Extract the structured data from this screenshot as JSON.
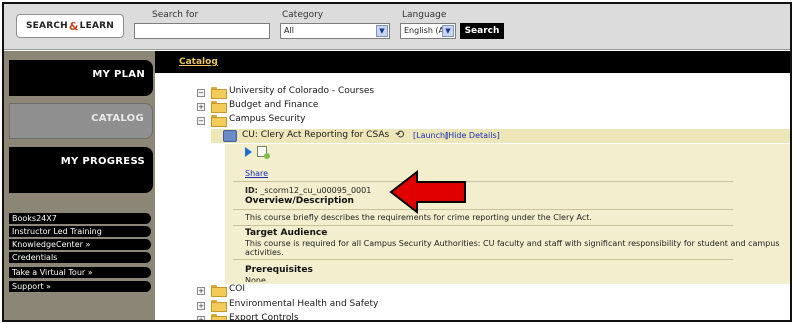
{
  "search": {
    "logo_text_left": "SEARCH",
    "logo_text_right": "LEARN",
    "logo_mark": "&",
    "search_for_label": "Search for",
    "search_value": "",
    "category_label": "Category",
    "category_value": "All",
    "language_label": "Language",
    "language_value": "English (All)",
    "button_label": "Search"
  },
  "sidebar": {
    "blocks": [
      "MY PLAN",
      "CATALOG",
      "MY PROGRESS"
    ],
    "links": [
      "Books24X7",
      "Instructor Led Training",
      "KnowledgeCenter  »",
      "Credentials",
      "Take a Virtual Tour  »",
      "Support  »"
    ]
  },
  "main": {
    "breadcrumb": "Catalog",
    "tree": {
      "root": "University of Colorado - Courses",
      "budget": "Budget and Finance",
      "campus_security": "Campus Security",
      "course_title": "CU: Clery Act Reporting for CSAs",
      "launch": "[Launch]",
      "hide_details": "[Hide Details]",
      "coi": "COI",
      "ehs": "Environmental Health and Safety",
      "export": "Export Controls"
    },
    "details": {
      "share": "Share",
      "id_label": "ID:",
      "id_value": "_scorm12_cu_u00095_0001",
      "overview_heading": "Overview/Description",
      "overview_text": "This course briefly describes the requirements for crime reporting under the Clery Act.",
      "audience_heading": "Target Audience",
      "audience_text_1": "This course is required for all Campus Security Authorities: CU faculty and staff with significant responsibility for student and campus",
      "audience_text_2": "activities.",
      "prereq_heading": "Prerequisites",
      "prereq_text": "None"
    }
  },
  "colors": {
    "sidebar_bg": "#8b8676",
    "panel_bg": "#f3eecd",
    "accent_red": "#e00000",
    "link_blue": "#1b2fb5"
  }
}
